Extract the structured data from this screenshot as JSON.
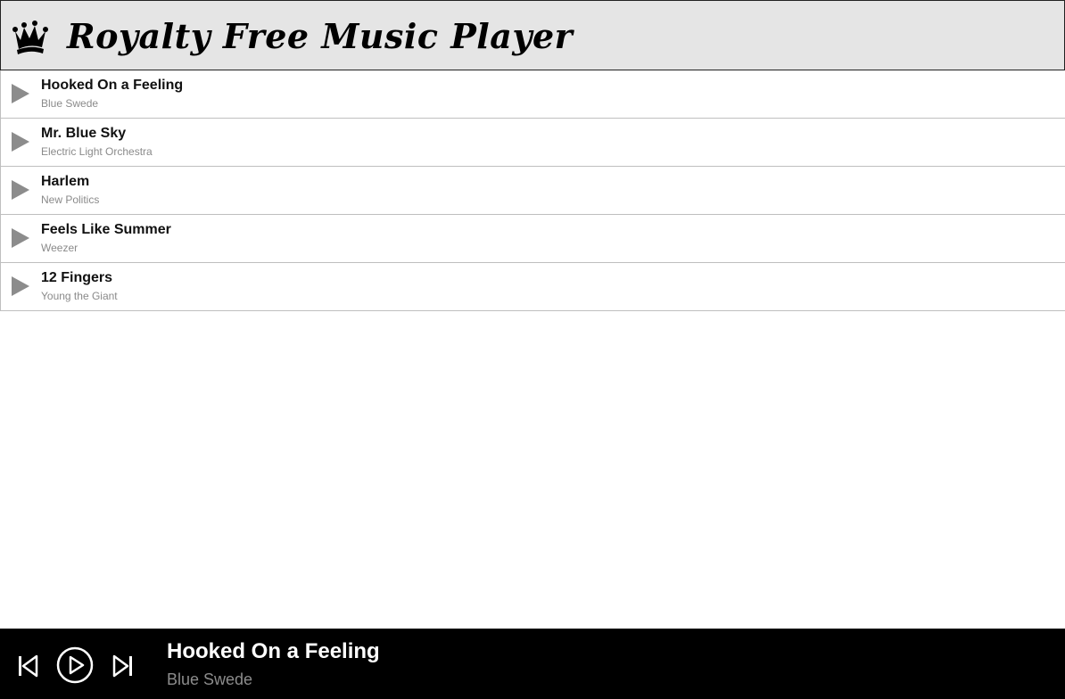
{
  "header": {
    "title": "Royalty Free Music Player",
    "logo_icon": "crown-icon"
  },
  "tracks": [
    {
      "title": "Hooked On a Feeling",
      "artist": "Blue Swede"
    },
    {
      "title": "Mr. Blue Sky",
      "artist": "Electric Light Orchestra"
    },
    {
      "title": "Harlem",
      "artist": "New Politics"
    },
    {
      "title": "Feels Like Summer",
      "artist": "Weezer"
    },
    {
      "title": "12 Fingers",
      "artist": "Young the Giant"
    }
  ],
  "player": {
    "now_playing_title": "Hooked On a Feeling",
    "now_playing_artist": "Blue Swede",
    "controls": [
      "skip-previous-icon",
      "play-circle-icon",
      "skip-next-icon"
    ]
  },
  "colors": {
    "header_bg": "#e5e5e5",
    "player_bg": "#000000",
    "row_play_icon": "#8c8c8c",
    "artist_text": "#8a8a8a"
  }
}
